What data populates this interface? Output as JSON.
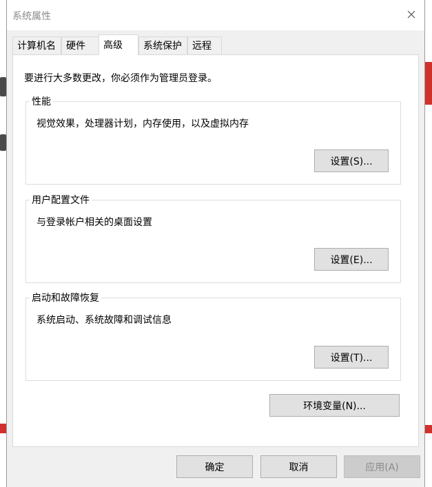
{
  "window": {
    "title": "系统属性"
  },
  "tabs": [
    {
      "label": "计算机名",
      "active": false
    },
    {
      "label": "硬件",
      "active": false
    },
    {
      "label": "高级",
      "active": true
    },
    {
      "label": "系统保护",
      "active": false
    },
    {
      "label": "远程",
      "active": false
    }
  ],
  "advanced": {
    "admin_note": "要进行大多数更改，你必须作为管理员登录。",
    "performance": {
      "title": "性能",
      "description": "视觉效果，处理器计划，内存使用，以及虚拟内存",
      "button": "设置(S)..."
    },
    "user_profiles": {
      "title": "用户配置文件",
      "description": "与登录帐户相关的桌面设置",
      "button": "设置(E)..."
    },
    "startup_recovery": {
      "title": "启动和故障恢复",
      "description": "系统启动、系统故障和调试信息",
      "button": "设置(T)..."
    },
    "env_button": "环境变量(N)..."
  },
  "footer": {
    "ok": "确定",
    "cancel": "取消",
    "apply": "应用(A)"
  },
  "colors": {
    "dialog_bg": "#f0f0f0",
    "panel_bg": "#ffffff",
    "button_bg": "#e1e1e1",
    "accent_red": "#d0312d"
  }
}
